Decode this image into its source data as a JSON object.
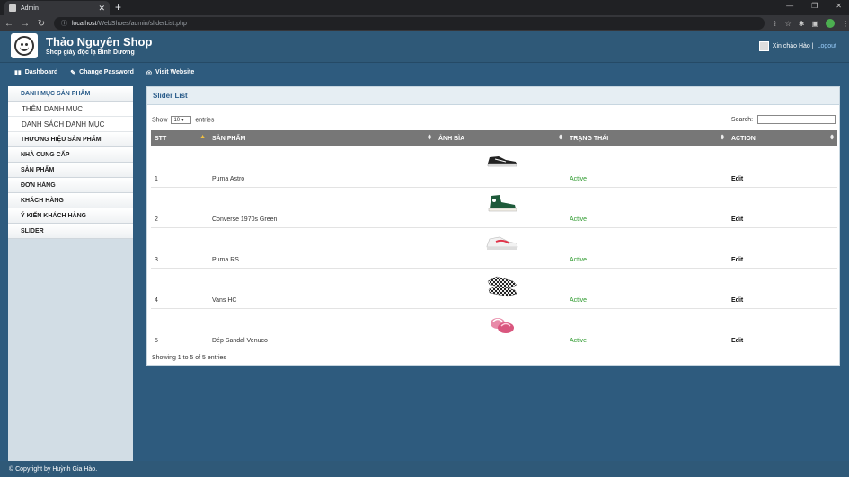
{
  "browser": {
    "tab_title": "Admin",
    "url_host": "localhost",
    "url_path": "/WebShoes/admin/sliderList.php"
  },
  "header": {
    "shop_name": "Thảo Nguyên Shop",
    "shop_sub": "Shop giày độc lạ Bình Dương",
    "greeting": "Xin chào Hào |",
    "logout": "Logout"
  },
  "nav": [
    "Dashboard",
    "Change Password",
    "Visit Website"
  ],
  "sidebar": {
    "items": [
      {
        "label": "DANH MỤC SẢN PHẨM",
        "type": "item"
      },
      {
        "label": "THÊM DANH MỤC",
        "type": "sub"
      },
      {
        "label": "DANH SÁCH DANH MỤC",
        "type": "sub"
      },
      {
        "label": "THƯƠNG HIỆU SẢN PHẨM",
        "type": "item"
      },
      {
        "label": "NHÀ CUNG CẤP",
        "type": "item"
      },
      {
        "label": "SẢN PHẨM",
        "type": "item"
      },
      {
        "label": "ĐƠN HÀNG",
        "type": "item"
      },
      {
        "label": "KHÁCH HÀNG",
        "type": "item"
      },
      {
        "label": "Ý KIẾN KHÁCH HÀNG",
        "type": "item"
      },
      {
        "label": "SLIDER",
        "type": "item"
      }
    ]
  },
  "panel": {
    "title": "Slider List",
    "show_label": "Show",
    "entries_value": "10",
    "entries_label": "entries",
    "search_label": "Search:",
    "showing": "Showing 1 to 5 of 5 entries"
  },
  "table": {
    "headers": [
      "STT",
      "SẢN PHẨM",
      "ẢNH BÌA",
      "TRẠNG THÁI",
      "ACTION"
    ],
    "rows": [
      {
        "stt": "1",
        "name": "Puma Astro",
        "status": "Active",
        "action": "Edit",
        "icon": "black-sneaker"
      },
      {
        "stt": "2",
        "name": "Converse 1970s Green",
        "status": "Active",
        "action": "Edit",
        "icon": "green-hightop"
      },
      {
        "stt": "3",
        "name": "Puma RS",
        "status": "Active",
        "action": "Edit",
        "icon": "white-red-sneaker"
      },
      {
        "stt": "4",
        "name": "Vans HC",
        "status": "Active",
        "action": "Edit",
        "icon": "checkered-slipon"
      },
      {
        "stt": "5",
        "name": "Dép Sandal Venuco",
        "status": "Active",
        "action": "Edit",
        "icon": "pink-sandal"
      }
    ]
  },
  "footer": "© Copyright by Huỳnh Gia Hào."
}
